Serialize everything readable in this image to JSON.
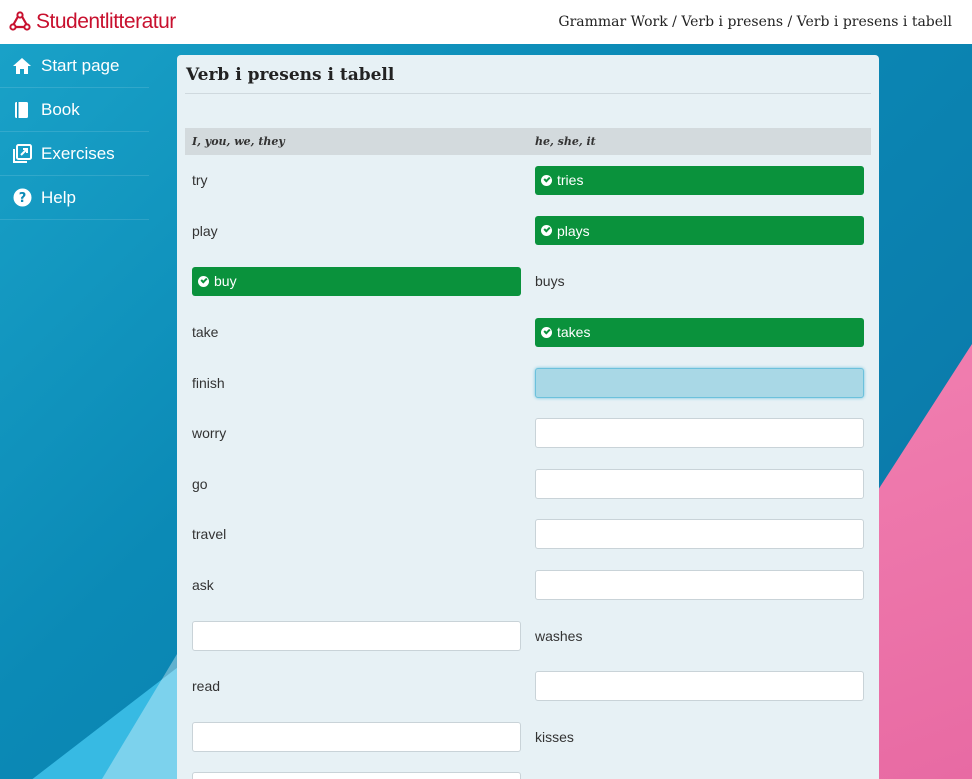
{
  "brand": {
    "name": "Studentlitteratur",
    "color": "#c8102e"
  },
  "breadcrumb": "Grammar Work / Verb i presens / Verb i presens i tabell",
  "sidebar": {
    "items": [
      {
        "label": "Start page",
        "icon": "home-icon"
      },
      {
        "label": "Book",
        "icon": "book-icon"
      },
      {
        "label": "Exercises",
        "icon": "exercises-icon"
      },
      {
        "label": "Help",
        "icon": "help-icon"
      }
    ]
  },
  "panel": {
    "title": "Verb i presens i tabell",
    "headers": [
      "I, you, we, they",
      "he, she, it"
    ]
  },
  "rows": [
    {
      "left": {
        "kind": "text",
        "value": "try"
      },
      "right": {
        "kind": "correct",
        "value": "tries"
      }
    },
    {
      "left": {
        "kind": "text",
        "value": "play"
      },
      "right": {
        "kind": "correct",
        "value": "plays"
      }
    },
    {
      "left": {
        "kind": "correct",
        "value": "buy"
      },
      "right": {
        "kind": "text",
        "value": "buys"
      }
    },
    {
      "left": {
        "kind": "text",
        "value": "take"
      },
      "right": {
        "kind": "correct",
        "value": "takes"
      }
    },
    {
      "left": {
        "kind": "text",
        "value": "finish"
      },
      "right": {
        "kind": "input",
        "value": "",
        "focused": true
      }
    },
    {
      "left": {
        "kind": "text",
        "value": "worry"
      },
      "right": {
        "kind": "input",
        "value": ""
      }
    },
    {
      "left": {
        "kind": "text",
        "value": "go"
      },
      "right": {
        "kind": "input",
        "value": ""
      }
    },
    {
      "left": {
        "kind": "text",
        "value": "travel"
      },
      "right": {
        "kind": "input",
        "value": ""
      }
    },
    {
      "left": {
        "kind": "text",
        "value": "ask"
      },
      "right": {
        "kind": "input",
        "value": ""
      }
    },
    {
      "left": {
        "kind": "input",
        "value": ""
      },
      "right": {
        "kind": "text",
        "value": "washes"
      }
    },
    {
      "left": {
        "kind": "text",
        "value": "read"
      },
      "right": {
        "kind": "input",
        "value": ""
      }
    },
    {
      "left": {
        "kind": "input",
        "value": ""
      },
      "right": {
        "kind": "text",
        "value": "kisses"
      }
    },
    {
      "left": {
        "kind": "input",
        "value": ""
      },
      "right": {
        "kind": "text",
        "value": ""
      }
    }
  ],
  "colors": {
    "correct": "#0a923c",
    "focused_input": "#a9d8e6"
  }
}
